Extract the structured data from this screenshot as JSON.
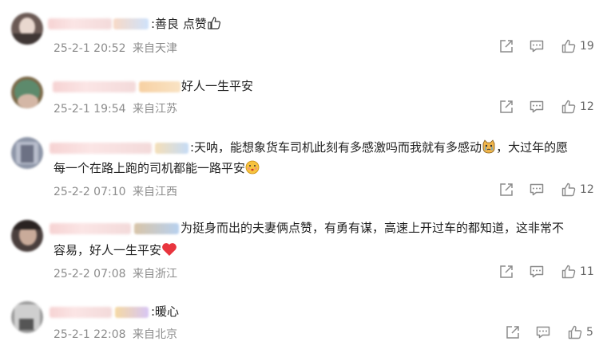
{
  "comments": [
    {
      "text": ":善良 点赞",
      "emoji": "thumbs-up",
      "time": "25-2-1 20:52",
      "location": "来自天津",
      "likes": "19"
    },
    {
      "text": "好人一生平安",
      "emoji": "",
      "time": "25-2-1 19:54",
      "location": "来自江苏",
      "likes": "12"
    },
    {
      "text": ":天呐，能想象货车司机此刻有多感激吗而我就有多感动",
      "text_cont": "，大过年的愿",
      "text_line2": "每一个在路上跑的司机都能一路平安",
      "emoji": "crying-cat",
      "emoji2": "kiss-face",
      "time": "25-2-2 07:10",
      "location": "来自江西",
      "likes": "12"
    },
    {
      "text": "为挺身而出的夫妻俩点赞，有勇有谋，高速上开过车的都知道，这非常不",
      "text_line2": "容易，好人一生平安",
      "emoji": "red-heart",
      "time": "25-2-2 07:08",
      "location": "来自浙江",
      "likes": "11"
    },
    {
      "text": ":暖心",
      "emoji": "",
      "time": "25-2-1 22:08",
      "location": "来自北京",
      "likes": "5"
    }
  ],
  "icons": {
    "share": "share-icon",
    "comment": "comment-icon",
    "like": "thumbs-up-icon"
  },
  "colors": {
    "meta": "#8c8c8c",
    "text": "#222222",
    "icon": "#8c8c8c",
    "heart": "#e8353e"
  }
}
